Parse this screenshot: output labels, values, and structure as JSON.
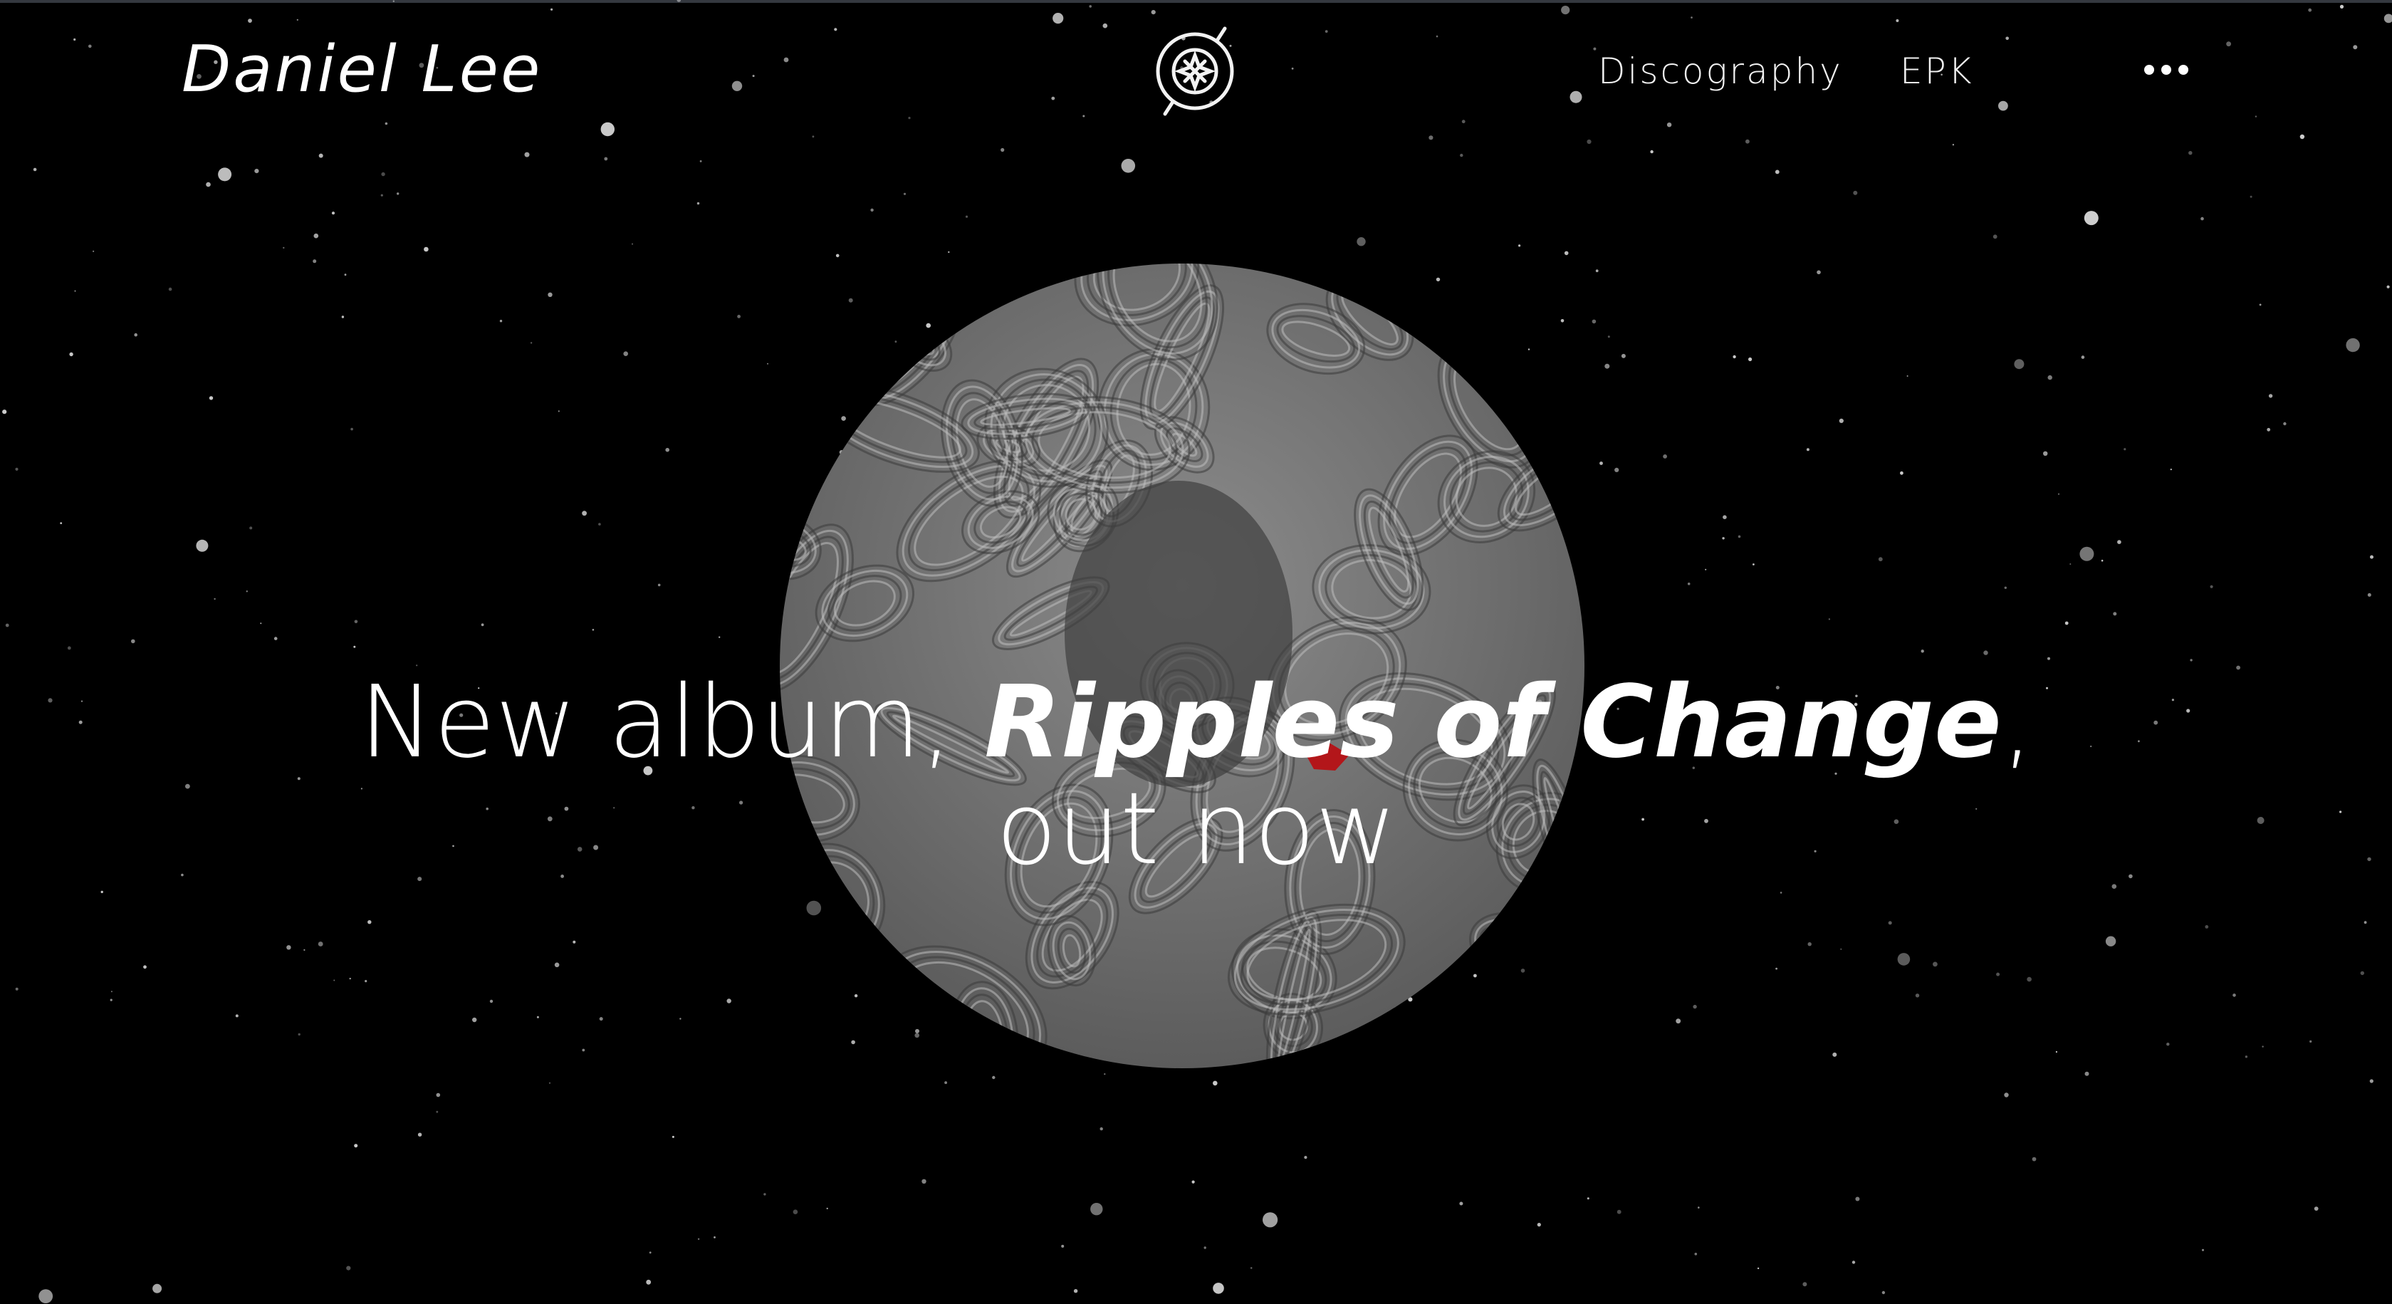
{
  "header": {
    "artist_name": "Daniel Lee",
    "logo_icon": "compass-emblem-icon",
    "nav": [
      {
        "label": "Discography"
      },
      {
        "label": "EPK"
      }
    ],
    "more_icon": "more-horizontal-icon"
  },
  "hero": {
    "headline_prefix": "New album, ",
    "album_title": "Ripples of Change",
    "headline_suffix": ", out now"
  },
  "colors": {
    "background": "#000000",
    "text": "#ffffff",
    "album_gray": "#8a8a8a",
    "accent_red": "#b3161a"
  }
}
